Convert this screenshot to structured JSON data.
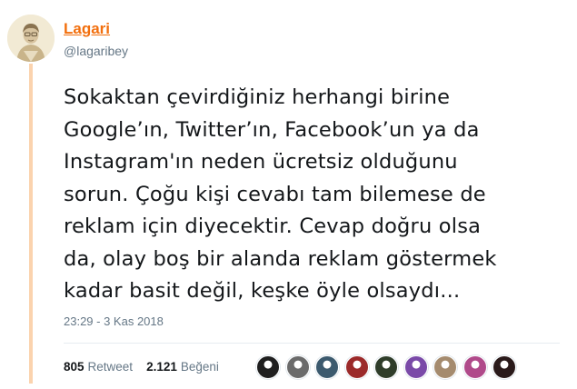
{
  "author": {
    "name": "Lagari",
    "handle": "@lagaribey"
  },
  "tweet": {
    "lines": [
      "Sokaktan çevirdiğiniz herhangi birine",
      "Google’ın, Twitter’ın, Facebook’un ya da",
      "Instagram'ın neden ücretsiz olduğunu",
      "sorun. Çoğu kişi cevabı tam bilemese de",
      "reklam için diyecektir. Cevap doğru olsa",
      "da, olay boş bir alanda reklam göstermek",
      "kadar basit değil, keşke öyle olsaydı..."
    ],
    "timestamp": "23:29 - 3 Kas 2018"
  },
  "stats": {
    "retweet_count": "805",
    "retweet_label": "Retweet",
    "like_count": "2.121",
    "like_label": "Beğeni"
  },
  "colors": {
    "accent": "#f26f0e",
    "thread_line": "#fbd3ae",
    "muted": "#657786"
  },
  "likers": [
    {
      "icon": "liker-avatar-1",
      "color": "#1f1f1f"
    },
    {
      "icon": "liker-avatar-2",
      "color": "#6b6b6b"
    },
    {
      "icon": "liker-avatar-3",
      "color": "#3c5a6e"
    },
    {
      "icon": "liker-avatar-4",
      "color": "#9b2a2a"
    },
    {
      "icon": "liker-avatar-5",
      "color": "#2f3d2a"
    },
    {
      "icon": "liker-avatar-6",
      "color": "#7a4aa8"
    },
    {
      "icon": "liker-avatar-7",
      "color": "#a58b6e"
    },
    {
      "icon": "liker-avatar-8",
      "color": "#b04a8a"
    },
    {
      "icon": "liker-avatar-9",
      "color": "#2a1a1a"
    }
  ]
}
